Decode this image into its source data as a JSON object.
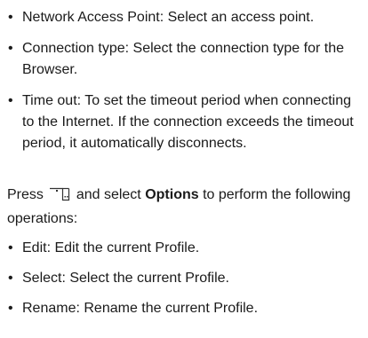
{
  "settings_items": [
    {
      "text": "Network Access Point: Select an access point."
    },
    {
      "text": "Connection type: Select the connection type for the Browser."
    },
    {
      "text": "Time out: To set the timeout period when connecting to the Internet. If the connection exceeds the timeout period, it automatically disconnects."
    }
  ],
  "press_paragraph": {
    "prefix": "Press",
    "icon": "menu-softkey-icon",
    "middle": "and select",
    "bold": "Options",
    "suffix": "to perform the following operations:"
  },
  "option_items": [
    {
      "text": "Edit: Edit the current Profile."
    },
    {
      "text": "Select: Select the current Profile."
    },
    {
      "text": "Rename: Rename the current Profile."
    }
  ]
}
